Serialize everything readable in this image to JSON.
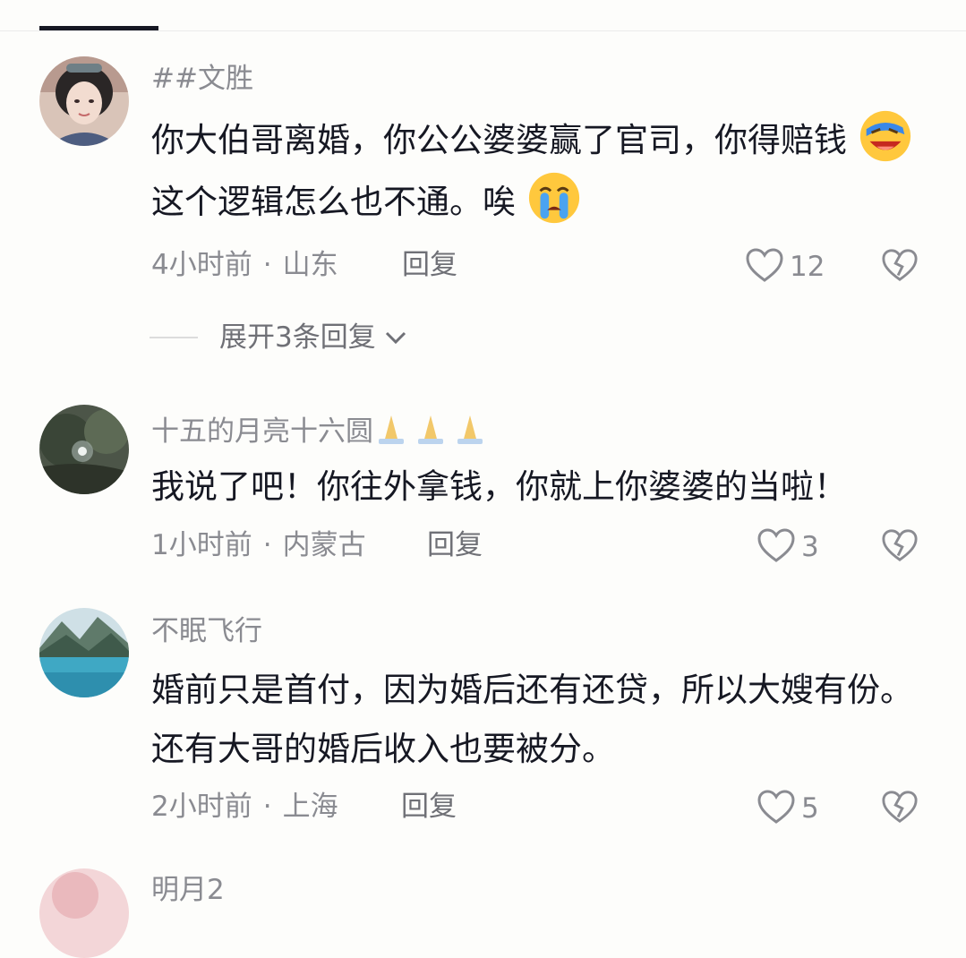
{
  "comments": [
    {
      "username": "##文胜",
      "text_part1": "你大伯哥离婚，你公公婆婆赢了官司，你得赔钱",
      "emoji1": "facepalm-laugh-emoji",
      "text_part2": "这个逻辑怎么也不通。唉",
      "emoji2": "crying-face-emoji",
      "time": "4小时前",
      "location": "山东",
      "reply_label": "回复",
      "likes": "12",
      "expand_label": "展开3条回复"
    },
    {
      "username": "十五的月亮十六圆",
      "username_emoji": "folded-hands-emoji",
      "text": "我说了吧！你往外拿钱，你就上你婆婆的当啦！",
      "time": "1小时前",
      "location": "内蒙古",
      "reply_label": "回复",
      "likes": "3"
    },
    {
      "username": "不眠飞行",
      "text": "婚前只是首付，因为婚后还有还贷，所以大嫂有份。还有大哥的婚后收入也要被分。",
      "time": "2小时前",
      "location": "上海",
      "reply_label": "回复",
      "likes": "5"
    },
    {
      "username": "明月2"
    }
  ],
  "separator": "·",
  "colors": {
    "text": "#161823",
    "muted": "#8a8b91",
    "reply": "#6f7076",
    "background": "#fdfdfb"
  }
}
